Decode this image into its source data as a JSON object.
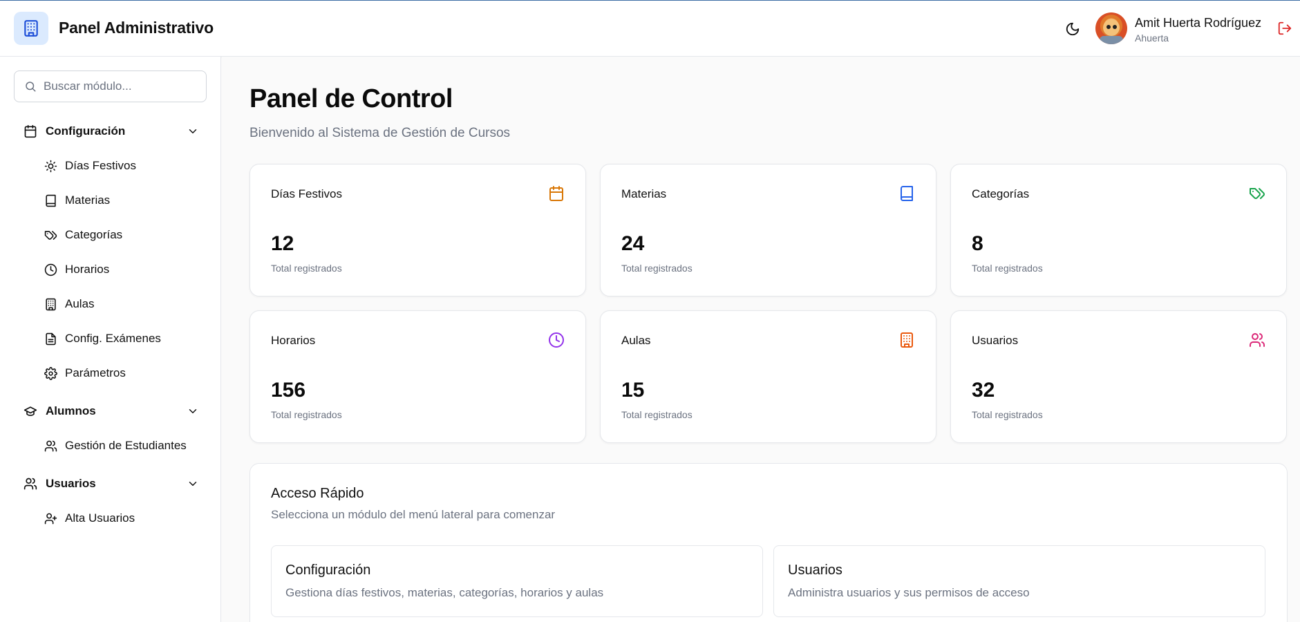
{
  "header": {
    "brand_icon": "building-icon",
    "title": "Panel Administrativo",
    "user": {
      "name": "Amit Huerta Rodríguez",
      "handle": "Ahuerta"
    },
    "accent": "#1d4ed8",
    "logout_color": "#dc2626"
  },
  "sidebar": {
    "search": {
      "placeholder": "Buscar módulo..."
    },
    "sections": [
      {
        "label": "Configuración",
        "icon": "calendar-icon",
        "items": [
          {
            "label": "Días Festivos",
            "icon": "sun-icon"
          },
          {
            "label": "Materias",
            "icon": "book-icon"
          },
          {
            "label": "Categorías",
            "icon": "tags-icon"
          },
          {
            "label": "Horarios",
            "icon": "clock-icon"
          },
          {
            "label": "Aulas",
            "icon": "building-icon"
          },
          {
            "label": "Config. Exámenes",
            "icon": "file-text-icon"
          },
          {
            "label": "Parámetros",
            "icon": "gear-icon"
          }
        ]
      },
      {
        "label": "Alumnos",
        "icon": "graduation-cap-icon",
        "items": [
          {
            "label": "Gestión de Estudiantes",
            "icon": "users-icon"
          }
        ]
      },
      {
        "label": "Usuarios",
        "icon": "users-icon",
        "items": [
          {
            "label": "Alta Usuarios",
            "icon": "user-plus-icon"
          }
        ]
      }
    ]
  },
  "main": {
    "title": "Panel de Control",
    "subtitle": "Bienvenido al Sistema de Gestión de Cursos",
    "stats": [
      {
        "title": "Días Festivos",
        "value": "12",
        "subtitle": "Total registrados",
        "icon": "calendar-icon",
        "color": "#d97706"
      },
      {
        "title": "Materias",
        "value": "24",
        "subtitle": "Total registrados",
        "icon": "book-icon",
        "color": "#2563eb"
      },
      {
        "title": "Categorías",
        "value": "8",
        "subtitle": "Total registrados",
        "icon": "tags-icon",
        "color": "#16a34a"
      },
      {
        "title": "Horarios",
        "value": "156",
        "subtitle": "Total registrados",
        "icon": "clock-icon",
        "color": "#9333ea"
      },
      {
        "title": "Aulas",
        "value": "15",
        "subtitle": "Total registrados",
        "icon": "building-icon",
        "color": "#ea580c"
      },
      {
        "title": "Usuarios",
        "value": "32",
        "subtitle": "Total registrados",
        "icon": "users-icon",
        "color": "#db2777"
      }
    ],
    "quick_access": {
      "title": "Acceso Rápido",
      "subtitle": "Selecciona un módulo del menú lateral para comenzar",
      "cards": [
        {
          "title": "Configuración",
          "description": "Gestiona días festivos, materias, categorías, horarios y aulas"
        },
        {
          "title": "Usuarios",
          "description": "Administra usuarios y sus permisos de acceso"
        }
      ]
    }
  }
}
